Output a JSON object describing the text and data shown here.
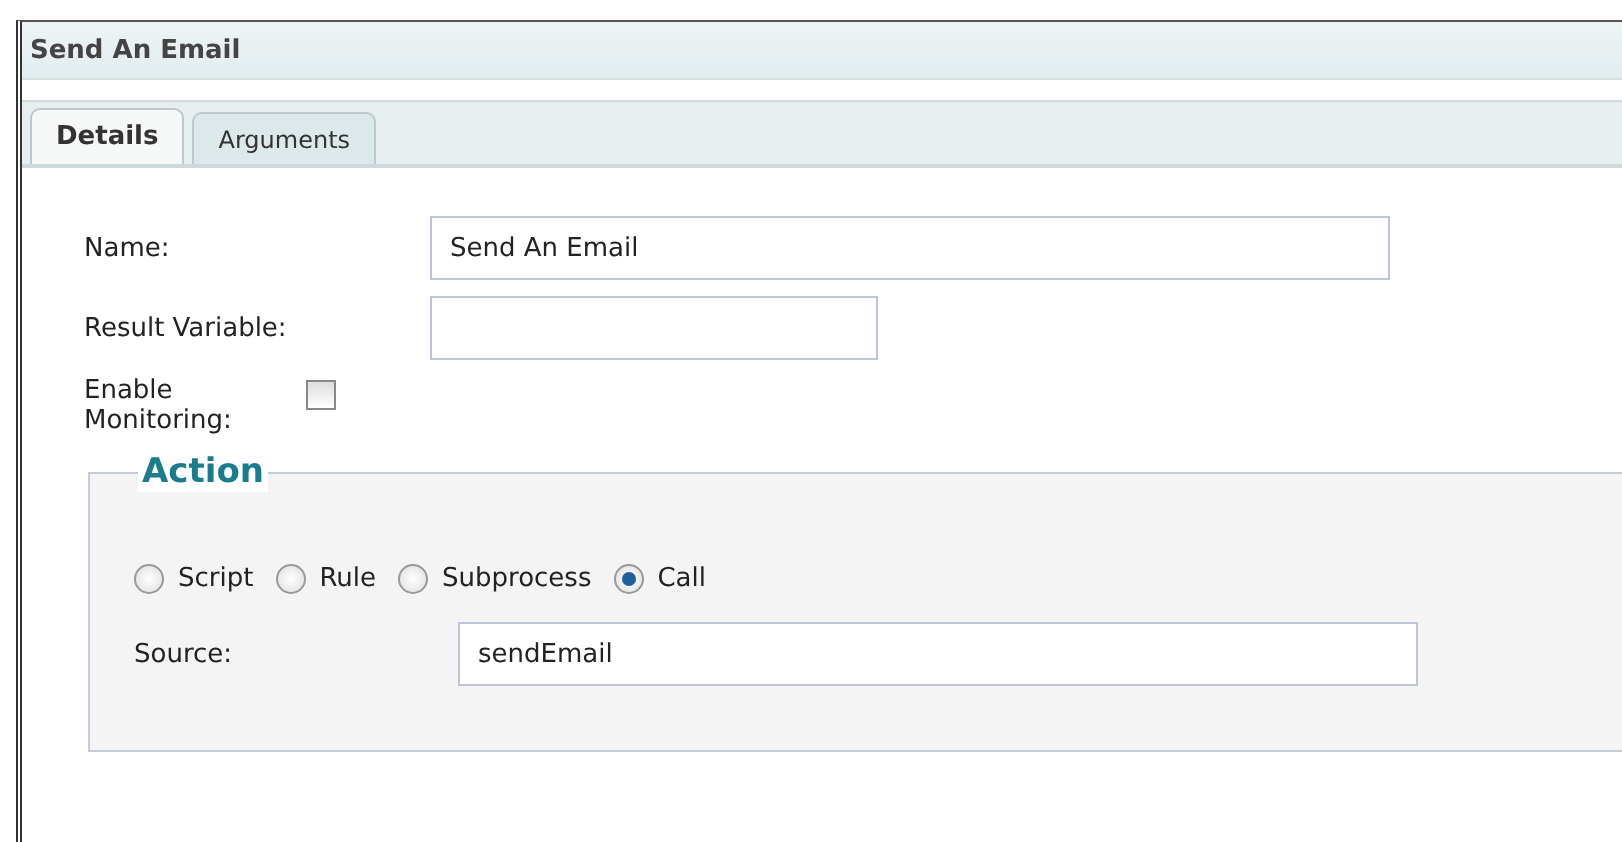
{
  "window": {
    "title": "Send An Email"
  },
  "tabs": [
    {
      "label": "Details",
      "selected": true
    },
    {
      "label": "Arguments",
      "selected": false
    }
  ],
  "fields": [
    {
      "label": "Name:",
      "kind": "text",
      "value": "Send An Email",
      "wide": true
    },
    {
      "label": "Result Variable:",
      "kind": "text",
      "wide": false
    },
    {
      "label": "Enable Monitoring:",
      "kind": "checkbox",
      "checked": false
    }
  ],
  "action": {
    "legend": "Action",
    "options": [
      {
        "label": "Script",
        "selected": false
      },
      {
        "label": "Rule",
        "selected": false
      },
      {
        "label": "Subprocess",
        "selected": false
      },
      {
        "label": "Call",
        "selected": true
      }
    ],
    "source": {
      "label": "Source:",
      "value": "sendEmail"
    }
  }
}
